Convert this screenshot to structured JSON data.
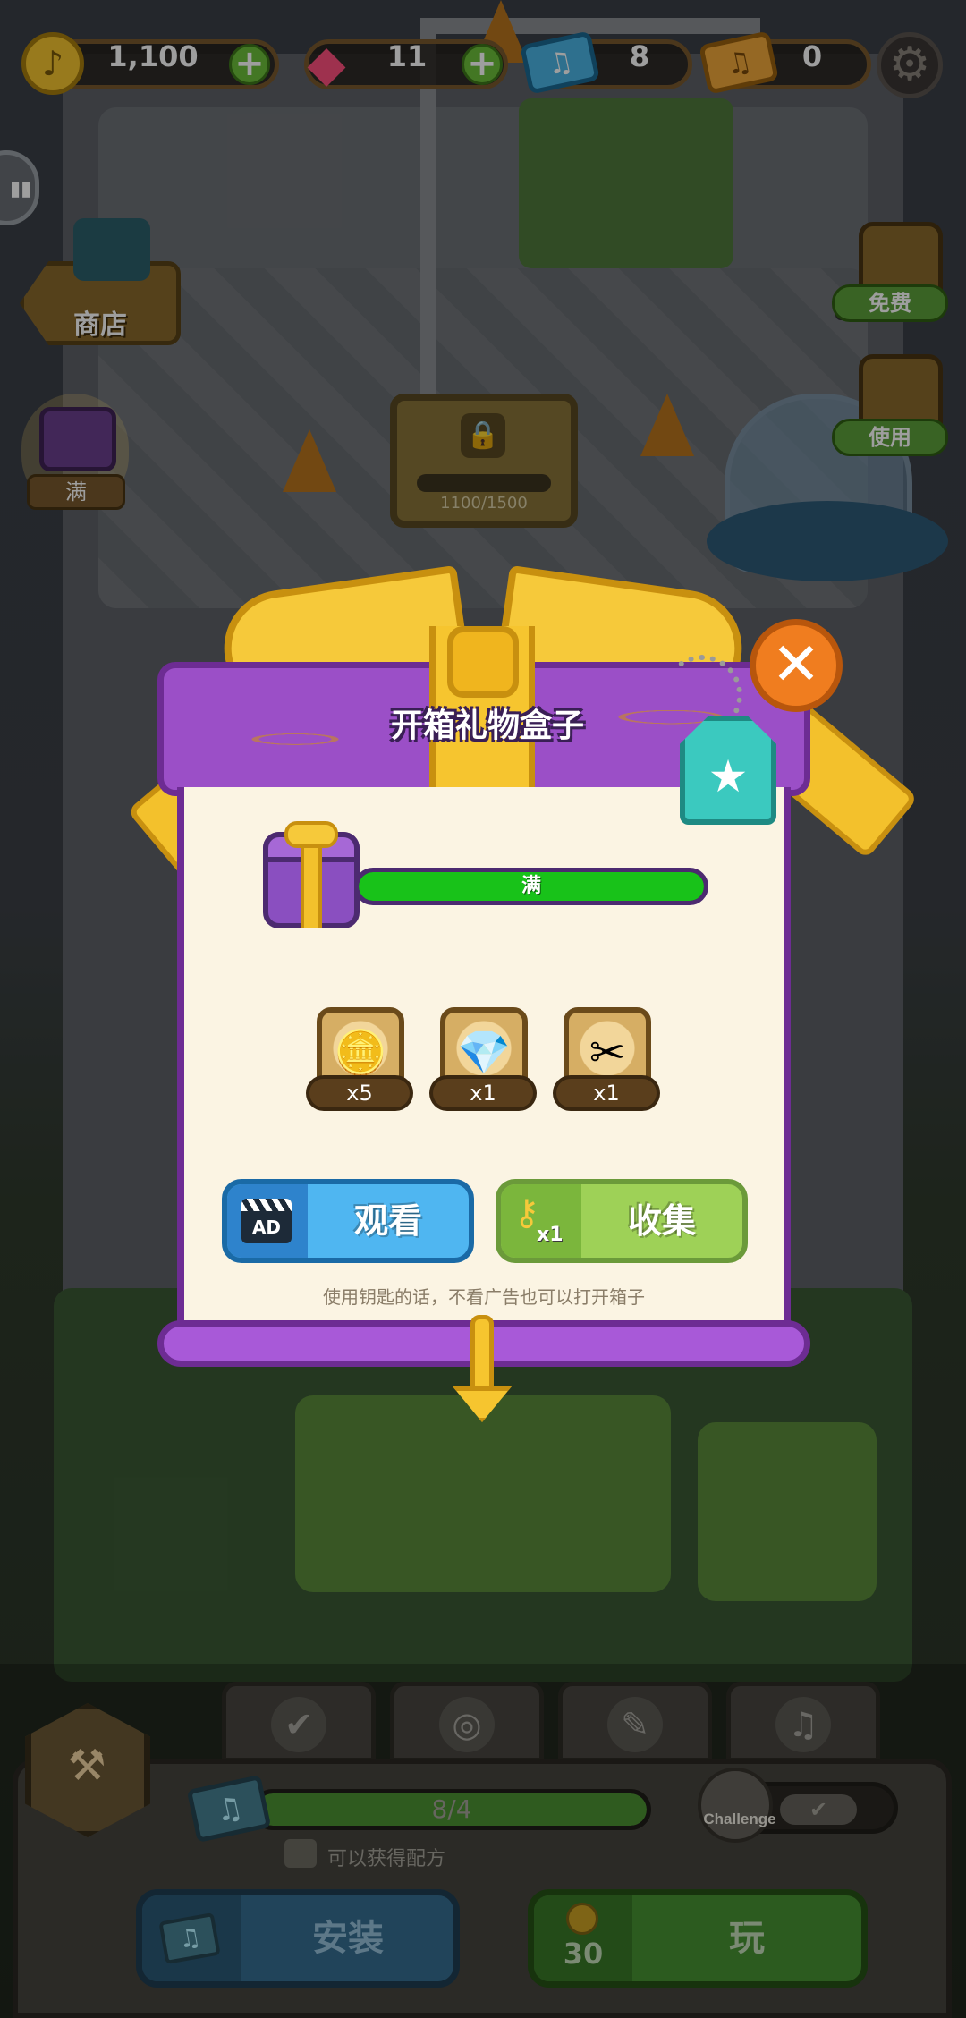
{
  "hud": {
    "coins": "1,100",
    "gems": "11",
    "tickets": "8",
    "golden_tickets": "0",
    "coin_icon": "music-note-coin-icon",
    "gem_icon": "gem-icon",
    "ticket_icon": "music-ticket-icon",
    "golden_ticket_icon": "golden-ticket-icon",
    "settings_icon": "gear-icon"
  },
  "side": {
    "shop_label": "商店",
    "gift_label": "满",
    "free_label": "免费",
    "use_label": "使用",
    "ad_tag": "AD"
  },
  "scene": {
    "locked_progress": "1100/1500"
  },
  "modal": {
    "title": "开箱礼物盒子",
    "progress_label": "满",
    "progress_fraction": 1.0,
    "rewards": [
      {
        "icon": "coins-icon",
        "qty": "x5"
      },
      {
        "icon": "gem-stand-icon",
        "qty": "x1"
      },
      {
        "icon": "scissors-icon",
        "qty": "x1"
      }
    ],
    "watch_ad_tag": "AD",
    "watch_label": "观看",
    "collect_key_qty": "x1",
    "collect_label": "收集",
    "hint": "使用钥匙的话，不看广告也可以打开箱子"
  },
  "bottom": {
    "note_progress": "8/4",
    "note_progress_fraction": 1.0,
    "recipe_hint": "可以获得配方",
    "challenge_label": "Challenge",
    "install_label": "安装",
    "play_cost": "30",
    "play_label": "玩"
  },
  "colors": {
    "modal_purple": "#9b4fc7",
    "ribbon_gold": "#f3c12c",
    "close_orange": "#f07d1f",
    "watch_blue": "#4fb6f1",
    "collect_green": "#9ed157",
    "progress_green": "#18c219"
  }
}
